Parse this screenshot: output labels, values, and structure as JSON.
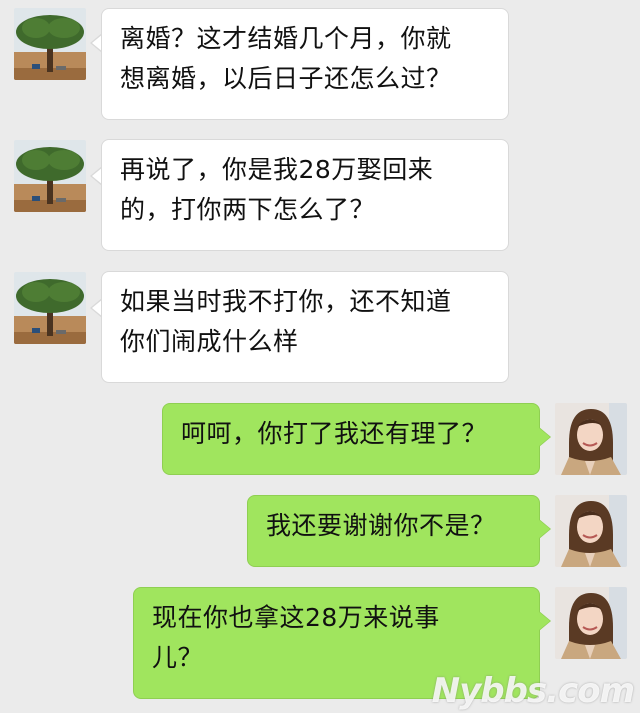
{
  "conversation": {
    "messages": [
      {
        "side": "left",
        "sender": "tree-avatar",
        "lines": [
          "离婚？这才结婚几个月，你就",
          "想离婚，以后日子还怎么过？"
        ]
      },
      {
        "side": "left",
        "sender": "tree-avatar",
        "lines": [
          "再说了，你是我28万娶回来",
          "的，打你两下怎么了？"
        ]
      },
      {
        "side": "left",
        "sender": "tree-avatar",
        "lines": [
          "如果当时我不打你，还不知道",
          "你们闹成什么样"
        ]
      },
      {
        "side": "right",
        "sender": "woman-avatar",
        "lines": [
          "呵呵，你打了我还有理了？"
        ]
      },
      {
        "side": "right",
        "sender": "woman-avatar",
        "lines": [
          "我还要谢谢你不是？"
        ]
      },
      {
        "side": "right",
        "sender": "woman-avatar",
        "lines": [
          "现在你也拿这28万来说事",
          "儿？"
        ]
      }
    ]
  },
  "watermark": {
    "text": "Nybbs.com"
  },
  "colors": {
    "background": "#ebebeb",
    "left_bubble": "#ffffff",
    "right_bubble": "#a0e55e"
  }
}
